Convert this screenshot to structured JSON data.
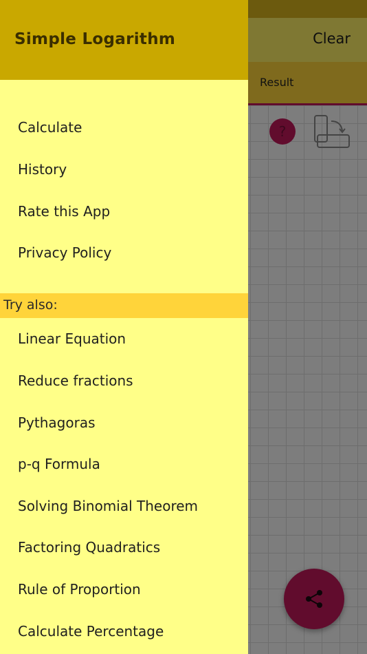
{
  "app": {
    "clear_label": "Clear",
    "result_label": "Result",
    "help_glyph": "?",
    "rotate_icon": "rotate-device-icon",
    "share_icon": "share-icon"
  },
  "drawer": {
    "title": "Simple Logarithm",
    "main_items": [
      {
        "label": "Calculate"
      },
      {
        "label": "History"
      },
      {
        "label": "Rate this App"
      },
      {
        "label": "Privacy Policy"
      }
    ],
    "try_also_label": "Try also:",
    "try_also_items": [
      {
        "label": "Linear Equation"
      },
      {
        "label": "Reduce fractions"
      },
      {
        "label": "Pythagoras"
      },
      {
        "label": "p-q Formula"
      },
      {
        "label": "Solving Binomial Theorem"
      },
      {
        "label": "Factoring Quadratics"
      },
      {
        "label": "Rule of Proportion"
      },
      {
        "label": "Calculate Percentage"
      }
    ]
  },
  "colors": {
    "drawer_background": "#ffff88",
    "drawer_header": "#c9a800",
    "section_header": "#ffd43a",
    "accent": "#c2185b"
  }
}
